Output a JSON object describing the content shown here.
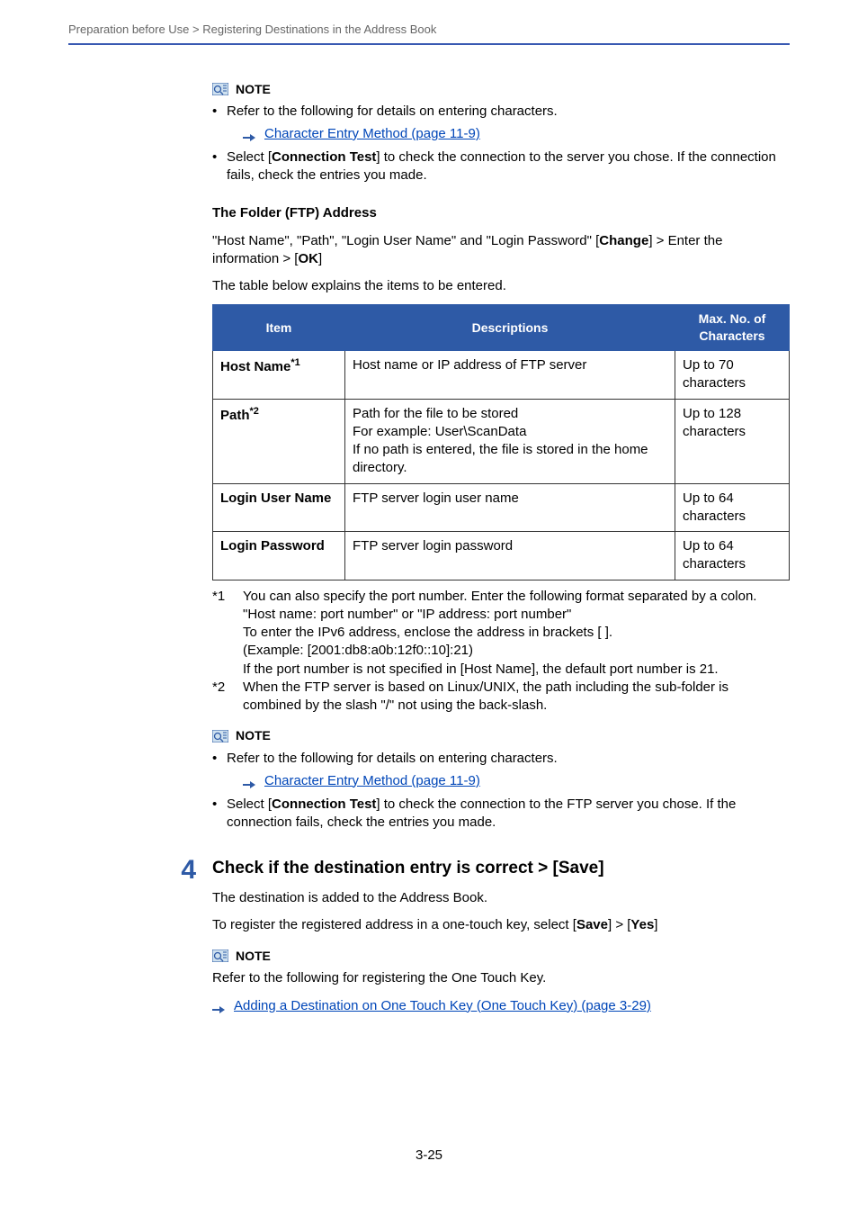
{
  "header": {
    "breadcrumb": "Preparation before Use > Registering Destinations in the Address Book"
  },
  "note1": {
    "label": "NOTE",
    "bullet1": "Refer to the following for details on entering characters.",
    "link1": "Character Entry Method (page 11-9)",
    "bullet2_pre": "Select [",
    "bullet2_bold": "Connection Test",
    "bullet2_post": "] to check the connection to the server you chose. If the connection fails, check the entries you made."
  },
  "ftp": {
    "heading": "The Folder (FTP) Address",
    "intro_pre": "\"Host Name\", \"Path\", \"Login User Name\" and \"Login Password\" [",
    "intro_b1": "Change",
    "intro_mid": "] > Enter the information > [",
    "intro_b2": "OK",
    "intro_post": "]",
    "table_intro": "The table below explains the items to be entered."
  },
  "table": {
    "h1": "Item",
    "h2": "Descriptions",
    "h3": "Max. No. of Characters",
    "r1_item": "Host Name",
    "r1_sup": "*1",
    "r1_desc": "Host name or IP address of FTP server",
    "r1_max": "Up to 70 characters",
    "r2_item": "Path",
    "r2_sup": "*2",
    "r2_desc": "Path for the file to be stored\nFor example: User\\ScanData\nIf no path is entered, the file is stored in the home directory.",
    "r2_max": "Up to 128 characters",
    "r3_item": "Login User Name",
    "r3_desc": "FTP server login user name",
    "r3_max": "Up to 64 characters",
    "r4_item": "Login Password",
    "r4_desc": "FTP server login password",
    "r4_max": "Up to 64 characters"
  },
  "footnotes": {
    "f1_tag": "*1",
    "f1_text": "You can also specify the port number. Enter the following format separated by a colon.\n\"Host name: port number\" or \"IP address: port number\"\nTo enter the IPv6 address, enclose the address in brackets [ ].\n(Example: [2001:db8:a0b:12f0::10]:21)\nIf the port number is not specified in [Host Name], the default port number is 21.",
    "f2_tag": "*2",
    "f2_text": "When the FTP server is based on Linux/UNIX, the path including the sub-folder is combined by the slash \"/\" not using the back-slash."
  },
  "note2": {
    "label": "NOTE",
    "bullet1": "Refer to the following for details on entering characters.",
    "link1": "Character Entry Method (page 11-9)",
    "bullet2_pre": "Select [",
    "bullet2_bold": "Connection Test",
    "bullet2_post": "] to check the connection to the FTP server you chose. If the connection fails, check the entries you made."
  },
  "step4": {
    "num": "4",
    "title": "Check if the destination entry is correct > [Save]",
    "p1": "The destination is added to the Address Book.",
    "p2_pre": "To register the registered address in a one-touch key, select [",
    "p2_b1": "Save",
    "p2_mid": "] > [",
    "p2_b2": "Yes",
    "p2_post": "]"
  },
  "note3": {
    "label": "NOTE",
    "text": "Refer to the following for registering the One Touch Key.",
    "link": "Adding a Destination on One Touch Key (One Touch Key) (page 3-29)"
  },
  "pageNumber": "3-25"
}
